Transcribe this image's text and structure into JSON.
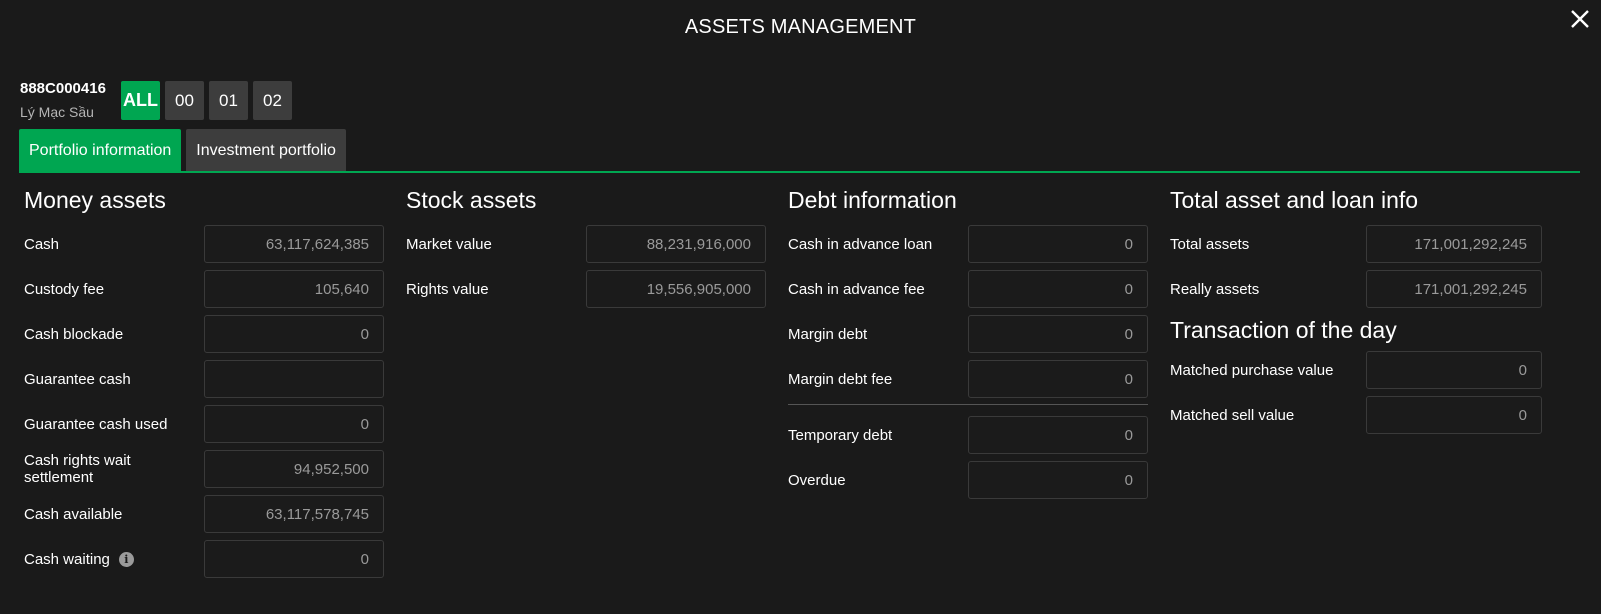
{
  "header": {
    "title": "ASSETS MANAGEMENT",
    "close_icon": "close-icon"
  },
  "account": {
    "id": "888C000416",
    "name": "Lý Mạc Sầu"
  },
  "sub_accounts": [
    "ALL",
    "00",
    "01",
    "02"
  ],
  "tabs": [
    "Portfolio information",
    "Investment portfolio"
  ],
  "colors": {
    "accent": "#00a651",
    "background": "#1a1a1a",
    "tab_inactive": "#3d3d3d"
  },
  "money_assets": {
    "title": "Money assets",
    "rows": [
      {
        "label": "Cash",
        "value": "63,117,624,385"
      },
      {
        "label": "Custody fee",
        "value": "105,640"
      },
      {
        "label": "Cash blockade",
        "value": "0"
      },
      {
        "label": "Guarantee cash",
        "value": ""
      },
      {
        "label": "Guarantee cash used",
        "value": "0"
      },
      {
        "label": "Cash rights wait settlement",
        "value": "94,952,500"
      },
      {
        "label": "Cash available",
        "value": "63,117,578,745"
      },
      {
        "label": "Cash waiting",
        "value": "0",
        "icon": "info-icon"
      }
    ]
  },
  "stock_assets": {
    "title": "Stock assets",
    "rows": [
      {
        "label": "Market value",
        "value": "88,231,916,000"
      },
      {
        "label": "Rights value",
        "value": "19,556,905,000"
      }
    ]
  },
  "debt_information": {
    "title": "Debt information",
    "rows": [
      {
        "label": "Cash in advance loan",
        "value": "0"
      },
      {
        "label": "Cash in advance fee",
        "value": "0"
      },
      {
        "label": "Margin debt",
        "value": "0"
      },
      {
        "label": "Margin debt fee",
        "value": "0"
      },
      {
        "label": "Temporary debt",
        "value": "0"
      },
      {
        "label": "Overdue",
        "value": "0"
      }
    ]
  },
  "total_asset": {
    "title": "Total asset and loan info",
    "rows": [
      {
        "label": "Total assets",
        "value": "171,001,292,245"
      },
      {
        "label": "Really assets",
        "value": "171,001,292,245"
      }
    ]
  },
  "transaction_of_day": {
    "title": "Transaction of the day",
    "rows": [
      {
        "label": "Matched purchase value",
        "value": "0"
      },
      {
        "label": "Matched sell value",
        "value": "0"
      }
    ]
  }
}
